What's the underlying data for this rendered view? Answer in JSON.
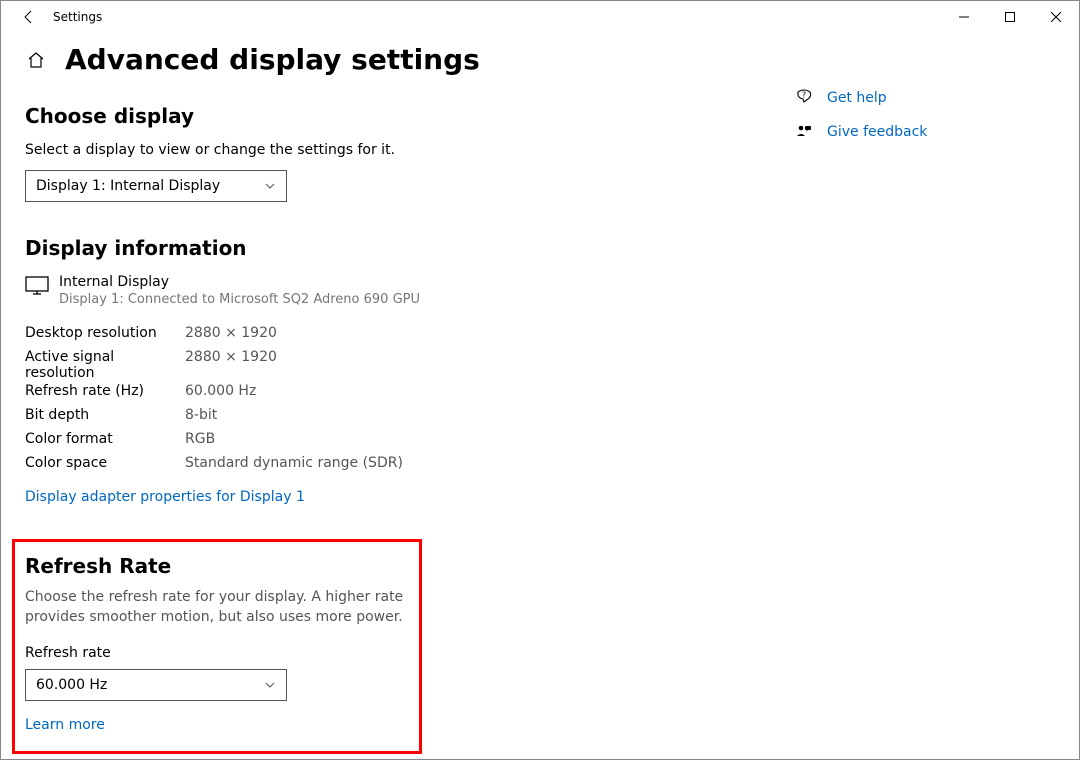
{
  "window": {
    "title": "Settings"
  },
  "page": {
    "title": "Advanced display settings"
  },
  "chooseDisplay": {
    "heading": "Choose display",
    "instruction": "Select a display to view or change the settings for it.",
    "selected": "Display 1: Internal Display"
  },
  "displayInfo": {
    "heading": "Display information",
    "name": "Internal Display",
    "connection": "Display 1: Connected to Microsoft SQ2 Adreno 690 GPU",
    "rows": [
      {
        "label": "Desktop resolution",
        "value": "2880 × 1920"
      },
      {
        "label": "Active signal resolution",
        "value": "2880 × 1920"
      },
      {
        "label": "Refresh rate (Hz)",
        "value": "60.000 Hz"
      },
      {
        "label": "Bit depth",
        "value": "8-bit"
      },
      {
        "label": "Color format",
        "value": "RGB"
      },
      {
        "label": "Color space",
        "value": "Standard dynamic range (SDR)"
      }
    ],
    "adapterLink": "Display adapter properties for Display 1"
  },
  "refreshRate": {
    "heading": "Refresh Rate",
    "description": "Choose the refresh rate for your display. A higher rate provides smoother motion, but also uses more power.",
    "fieldLabel": "Refresh rate",
    "selected": "60.000 Hz",
    "learnMore": "Learn more"
  },
  "side": {
    "help": "Get help",
    "feedback": "Give feedback"
  }
}
